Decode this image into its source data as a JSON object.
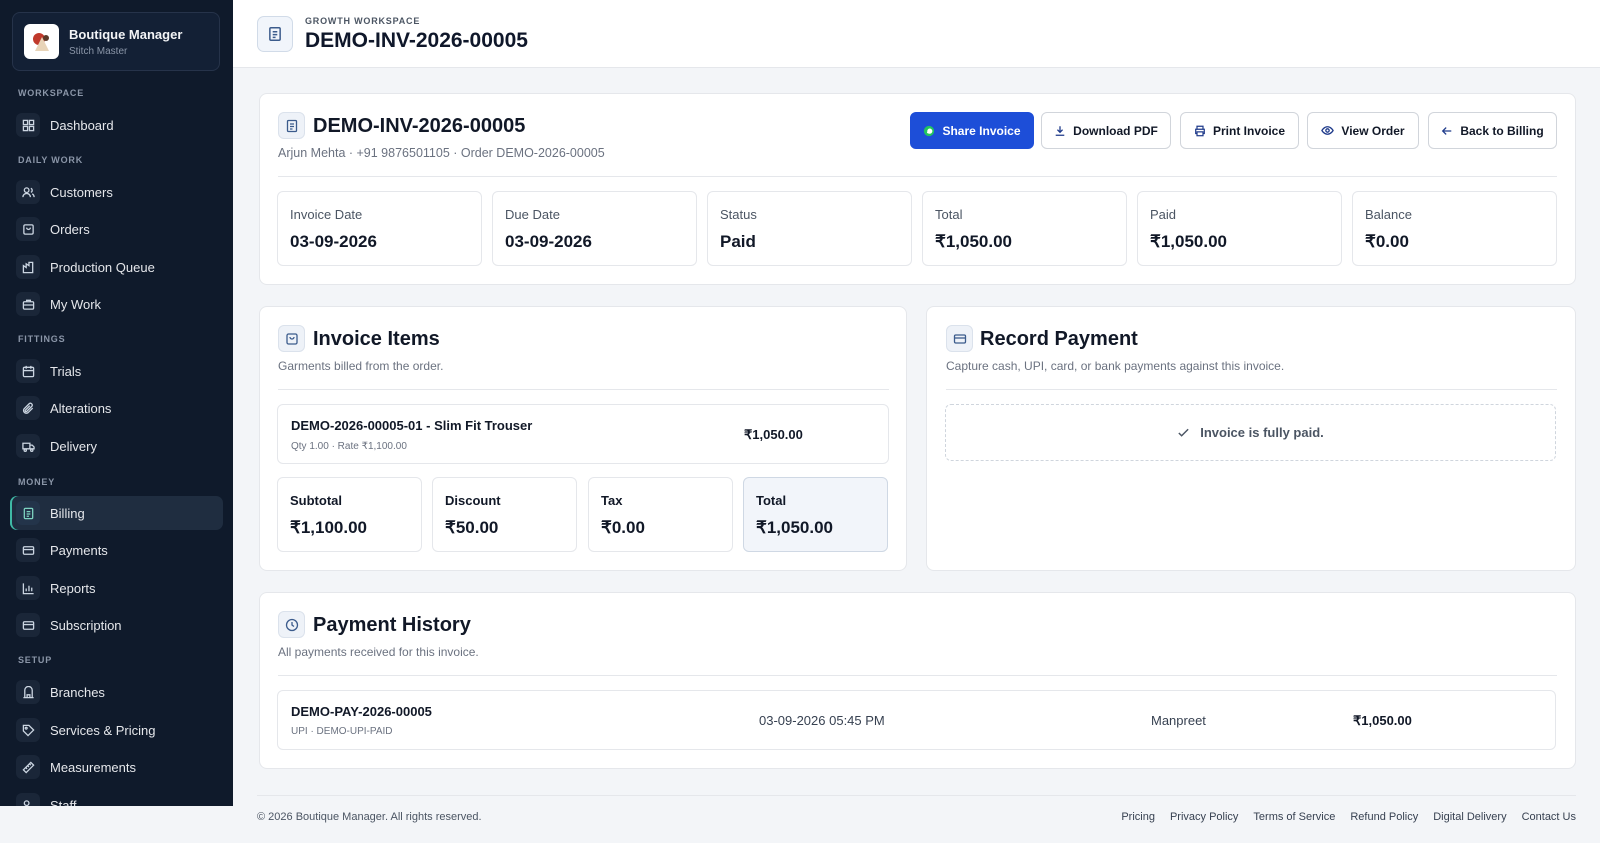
{
  "brand": {
    "title": "Boutique Manager",
    "subtitle": "Stitch Master"
  },
  "sidebar": {
    "sections": [
      "WORKSPACE",
      "DAILY WORK",
      "FITTINGS",
      "MONEY",
      "SETUP"
    ],
    "items": [
      {
        "label": "Dashboard",
        "icon": "grid-icon"
      },
      {
        "label": "Customers",
        "icon": "users-icon"
      },
      {
        "label": "Orders",
        "icon": "bag-icon"
      },
      {
        "label": "Production Queue",
        "icon": "factory-icon"
      },
      {
        "label": "My Work",
        "icon": "briefcase-icon"
      },
      {
        "label": "Trials",
        "icon": "calendar-icon"
      },
      {
        "label": "Alterations",
        "icon": "paperclip-icon"
      },
      {
        "label": "Delivery",
        "icon": "truck-icon"
      },
      {
        "label": "Billing",
        "icon": "receipt-icon",
        "active": true
      },
      {
        "label": "Payments",
        "icon": "card-icon"
      },
      {
        "label": "Reports",
        "icon": "bar-chart-icon"
      },
      {
        "label": "Subscription",
        "icon": "card-icon"
      },
      {
        "label": "Branches",
        "icon": "building-icon"
      },
      {
        "label": "Services & Pricing",
        "icon": "tag-icon"
      },
      {
        "label": "Measurements",
        "icon": "ruler-icon"
      },
      {
        "label": "Staff",
        "icon": "users-icon"
      }
    ]
  },
  "header": {
    "eyebrow": "GROWTH WORKSPACE",
    "title": "DEMO-INV-2026-00005"
  },
  "invoice": {
    "title": "DEMO-INV-2026-00005",
    "subtitle": "Arjun Mehta · +91 9876501105 · Order DEMO-2026-00005",
    "actions": {
      "share": "Share Invoice",
      "download": "Download PDF",
      "print": "Print Invoice",
      "view_order": "View Order",
      "back": "Back to Billing"
    },
    "stats": [
      {
        "label": "Invoice Date",
        "value": "03-09-2026"
      },
      {
        "label": "Due Date",
        "value": "03-09-2026"
      },
      {
        "label": "Status",
        "value": "Paid"
      },
      {
        "label": "Total",
        "value": "₹1,050.00"
      },
      {
        "label": "Paid",
        "value": "₹1,050.00"
      },
      {
        "label": "Balance",
        "value": "₹0.00"
      }
    ]
  },
  "items_card": {
    "title": "Invoice Items",
    "subtitle": "Garments billed from the order.",
    "items": [
      {
        "name": "DEMO-2026-00005-01 - Slim Fit Trouser",
        "meta": "Qty 1.00 · Rate ₹1,100.00",
        "amount": "₹1,050.00"
      }
    ],
    "summary": [
      {
        "label": "Subtotal",
        "value": "₹1,100.00"
      },
      {
        "label": "Discount",
        "value": "₹50.00"
      },
      {
        "label": "Tax",
        "value": "₹0.00"
      },
      {
        "label": "Total",
        "value": "₹1,050.00"
      }
    ]
  },
  "payment_card": {
    "title": "Record Payment",
    "subtitle": "Capture cash, UPI, card, or bank payments against this invoice.",
    "paid_message": "Invoice is fully paid."
  },
  "history": {
    "title": "Payment History",
    "subtitle": "All payments received for this invoice.",
    "rows": [
      {
        "id": "DEMO-PAY-2026-00005",
        "meta": "UPI · DEMO-UPI-PAID",
        "date": "03-09-2026 05:45 PM",
        "by": "Manpreet",
        "amount": "₹1,050.00"
      }
    ]
  },
  "footer": {
    "copyright": "© 2026 Boutique Manager. All rights reserved.",
    "links": [
      "Pricing",
      "Privacy Policy",
      "Terms of Service",
      "Refund Policy",
      "Digital Delivery",
      "Contact Us"
    ]
  },
  "colors": {
    "sidebar_bg": "#0f1a2b",
    "primary": "#1d4ed8",
    "accent": "#3fb9a5"
  }
}
